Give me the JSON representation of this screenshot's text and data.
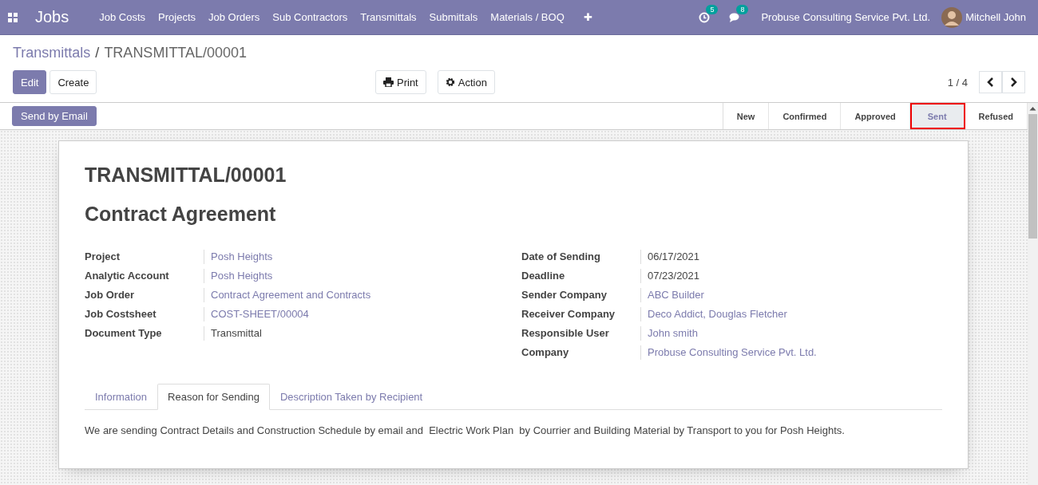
{
  "navbar": {
    "app_name": "Jobs",
    "menu": [
      "Job Costs",
      "Projects",
      "Job Orders",
      "Sub Contractors",
      "Transmittals",
      "Submittals",
      "Materials / BOQ"
    ],
    "plus": "✚",
    "activity_count": "5",
    "message_count": "8",
    "company": "Probuse Consulting Service Pvt. Ltd.",
    "user": "Mitchell John"
  },
  "breadcrumb": {
    "parent": "Transmittals",
    "separator": "/",
    "current": "TRANSMITTAL/00001"
  },
  "buttons": {
    "edit": "Edit",
    "create": "Create",
    "print": "Print",
    "action": "Action"
  },
  "pager": {
    "text": "1 / 4"
  },
  "header_button": "Send by Email",
  "stages": [
    {
      "label": "New",
      "selected": false
    },
    {
      "label": "Confirmed",
      "selected": false
    },
    {
      "label": "Approved",
      "selected": false
    },
    {
      "label": "Sent",
      "selected": true
    },
    {
      "label": "Refused",
      "selected": false
    }
  ],
  "sheet": {
    "number": "TRANSMITTAL/00001",
    "title": "Contract Agreement",
    "left_fields": [
      {
        "label": "Project",
        "value": "Posh Heights",
        "link": true
      },
      {
        "label": "Analytic Account",
        "value": "Posh Heights",
        "link": true
      },
      {
        "label": "Job Order",
        "value": "Contract Agreement and Contracts",
        "link": true
      },
      {
        "label": "Job Costsheet",
        "value": "COST-SHEET/00004",
        "link": true
      },
      {
        "label": "Document Type",
        "value": "Transmittal",
        "link": false
      }
    ],
    "right_fields": [
      {
        "label": "Date of Sending",
        "value": "06/17/2021",
        "link": false
      },
      {
        "label": "Deadline",
        "value": "07/23/2021",
        "link": false
      },
      {
        "label": "Sender Company",
        "value": "ABC Builder",
        "link": true
      },
      {
        "label": "Receiver Company",
        "value": "Deco Addict, Douglas Fletcher",
        "link": true
      },
      {
        "label": "Responsible User",
        "value": "John smith",
        "link": true
      },
      {
        "label": "Company",
        "value": "Probuse Consulting Service Pvt. Ltd.",
        "link": true
      }
    ],
    "tabs": [
      {
        "label": "Information",
        "selected": false
      },
      {
        "label": "Reason for Sending",
        "selected": true
      },
      {
        "label": "Description Taken by Recipient",
        "selected": false
      }
    ],
    "tab_content": "We are sending Contract Details and Construction Schedule by email and  Electric Work Plan  by Courrier and Building Material by Transport to you for Posh Heights."
  }
}
